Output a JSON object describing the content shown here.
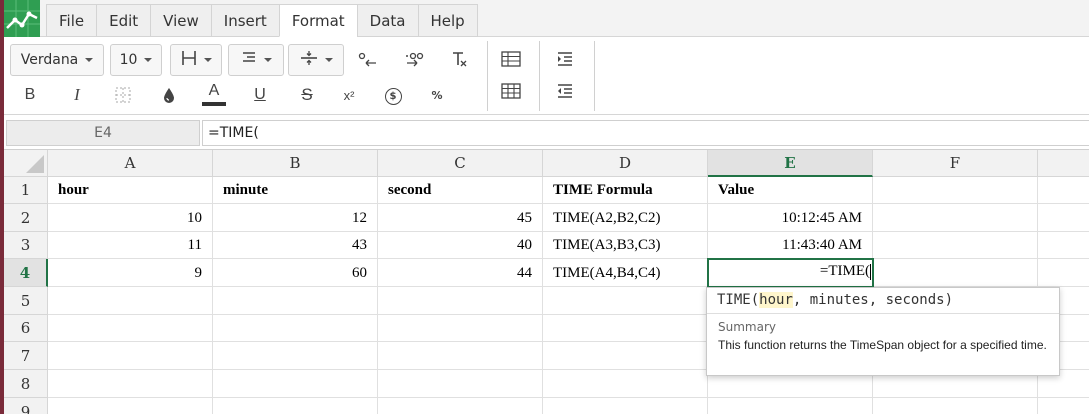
{
  "menu": {
    "tabs": [
      "File",
      "Edit",
      "View",
      "Insert",
      "Format",
      "Data",
      "Help"
    ],
    "active_tab": "Format"
  },
  "toolbar": {
    "font_name": "Verdana",
    "font_size": "10",
    "buttons": {
      "bold": "B",
      "italic": "I",
      "text_color": "A",
      "underline": "U",
      "strikethrough": "S",
      "superscript": "x²",
      "currency": "$",
      "percent": "%"
    }
  },
  "formula_bar": {
    "name_box": "E4",
    "formula": "=TIME("
  },
  "grid": {
    "columns": [
      "A",
      "B",
      "C",
      "D",
      "E",
      "F"
    ],
    "rows": [
      "1",
      "2",
      "3",
      "4",
      "5",
      "6",
      "7",
      "8",
      "9"
    ],
    "cells": [
      [
        "hour",
        "minute",
        "second",
        "TIME Formula",
        "Value",
        ""
      ],
      [
        "10",
        "12",
        "45",
        "TIME(A2,B2,C2)",
        "10:12:45 AM",
        ""
      ],
      [
        "11",
        "43",
        "40",
        "TIME(A3,B3,C3)",
        "11:43:40 AM",
        ""
      ],
      [
        "9",
        "60",
        "44",
        "TIME(A4,B4,C4)",
        "=TIME(",
        ""
      ]
    ],
    "selected_column": "E",
    "selected_row": "4"
  },
  "tooltip": {
    "function_name": "TIME(",
    "param_current": "hour",
    "param_rest": ", minutes, seconds)",
    "summary_label": "Summary",
    "description": "This function returns the TimeSpan object for a specified time."
  },
  "colors": {
    "accent": "#217346",
    "logo": "#2f9e52",
    "highlight": "#fff6cc"
  }
}
